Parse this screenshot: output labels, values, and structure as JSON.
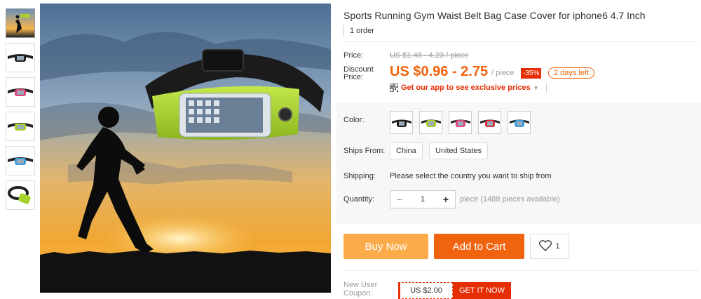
{
  "product": {
    "title": "Sports Running Gym Waist Belt Bag Case Cover for iphone6 4.7 Inch",
    "orders": "1 order"
  },
  "price": {
    "label": "Price:",
    "original": "US $1.48 - 4.23 / piece",
    "discount_label_1": "Discount",
    "discount_label_2": "Price:",
    "current": "US $0.96 - 2.75",
    "unit": "/ piece",
    "discount_badge": "-35%",
    "time_left": "2 days left",
    "app_promo": "Get our app to see exclusive prices"
  },
  "color": {
    "label": "Color:",
    "swatch_colors": [
      "#1a1a1a",
      "#a6d22b",
      "#e4417a",
      "#d42d3a",
      "#3a9ddc"
    ]
  },
  "ships_from": {
    "label": "Ships From:",
    "options": [
      "China",
      "United States"
    ]
  },
  "shipping": {
    "label": "Shipping:",
    "text": "Please select the country you want to ship from"
  },
  "quantity": {
    "label": "Quantity:",
    "value": "1",
    "available": "piece (1488 pieces available)"
  },
  "actions": {
    "buy_now": "Buy Now",
    "add_to_cart": "Add to Cart",
    "wishlist_count": "1"
  },
  "coupon": {
    "label_1": "New User",
    "label_2": "Coupon:",
    "amount": "US $2.00",
    "get": "GET IT NOW"
  },
  "colors": {
    "accent": "#f0630f",
    "buy": "#fbab4a",
    "red": "#e62e04"
  }
}
